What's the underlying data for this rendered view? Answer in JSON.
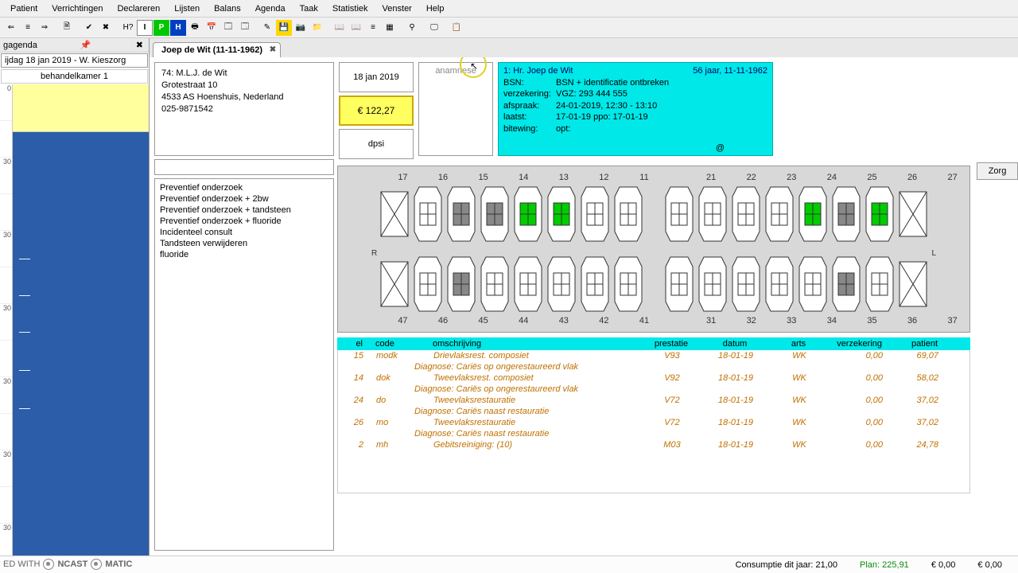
{
  "menubar": [
    "Patient",
    "Verrichtingen",
    "Declareren",
    "Lijsten",
    "Balans",
    "Agenda",
    "Taak",
    "Statistiek",
    "Venster",
    "Help"
  ],
  "toolbar_icons": [
    "⇐",
    "≡",
    "⇒",
    "",
    "🗎",
    "",
    "✔",
    "✖",
    "",
    "H?",
    "I",
    "P",
    "H",
    "🖶",
    "📅",
    "🗔",
    "🗔",
    "",
    "✎",
    "💾",
    "📷",
    "📁",
    "",
    "📖",
    "📖",
    "≡",
    "▦",
    "",
    "⚲",
    "",
    "🖵",
    "",
    "📋"
  ],
  "agenda": {
    "header": "gagenda",
    "date": "ijdag 18 jan 2019 - W. Kieszorg",
    "room": "behandelkamer 1",
    "times": [
      "0",
      "",
      "30",
      "",
      "30",
      "",
      "30",
      "",
      "30",
      "",
      "30",
      "",
      "30"
    ]
  },
  "tab": {
    "label": "Joep de Wit (11-11-1962)"
  },
  "address": {
    "l1": "74:  M.L.J. de Wit",
    "l2": "Grotestraat 10",
    "l3": "4533 AS  Hoenshuis, Nederland",
    "l4": "025-9871542"
  },
  "procedures": [
    "Preventief onderzoek",
    "Preventief onderzoek + 2bw",
    "Preventief onderzoek + tandsteen",
    "Preventief onderzoek + fluoride",
    "Incidenteel consult",
    "Tandsteen verwijderen",
    "fluoride"
  ],
  "box": {
    "date": "18 jan 2019",
    "price": "€ 122,27",
    "dpsi": "dpsi",
    "anam": "anamnese"
  },
  "info": {
    "name": "1: Hr. Joep de Wit",
    "age": "56 jaar, 11-11-1962",
    "r1l": "BSN:",
    "r1v": "BSN + identificatie ontbreken",
    "r2l": "verzekering:",
    "r2v": "VGZ: 293 444 555",
    "r3l": "afspraak:",
    "r3v": "24-01-2019, 12:30 - 13:10",
    "r4l": "laatst:",
    "r4v": "17-01-19    ppo: 17-01-19",
    "r5l": "bitewing:",
    "r5v": "              opt:",
    "mail": "@"
  },
  "zorg": "Zorg",
  "teeth_upper": [
    "17",
    "16",
    "15",
    "14",
    "13",
    "12",
    "11",
    "",
    "21",
    "22",
    "23",
    "24",
    "25",
    "26",
    "27"
  ],
  "teeth_lower": [
    "47",
    "46",
    "45",
    "44",
    "43",
    "42",
    "41",
    "",
    "31",
    "32",
    "33",
    "34",
    "35",
    "36",
    "37"
  ],
  "rl": {
    "r": "R",
    "l": "L"
  },
  "grid": {
    "headers": {
      "el": "el",
      "code": "code",
      "desc": "omschrijving",
      "pres": "prestatie",
      "date": "datum",
      "arts": "arts",
      "verz": "verzekering",
      "pat": "patient"
    },
    "rows": [
      {
        "el": "15",
        "code": "modk",
        "desc": "Drievlaksrest. composiet",
        "pres": "V93",
        "date": "18-01-19",
        "arts": "WK",
        "verz": "0,00",
        "pat": "69,07",
        "diag": "Diagnose: Cariës op ongerestaureerd vlak"
      },
      {
        "el": "14",
        "code": "dok",
        "desc": "Tweevlaksrest. composiet",
        "pres": "V92",
        "date": "18-01-19",
        "arts": "WK",
        "verz": "0,00",
        "pat": "58,02",
        "diag": "Diagnose: Cariës op ongerestaureerd vlak"
      },
      {
        "el": "24",
        "code": "do",
        "desc": "Tweevlaksrestauratie",
        "pres": "V72",
        "date": "18-01-19",
        "arts": "WK",
        "verz": "0,00",
        "pat": "37,02",
        "diag": "Diagnose: Cariës naast restauratie"
      },
      {
        "el": "26",
        "code": "mo",
        "desc": "Tweevlaksrestauratie",
        "pres": "V72",
        "date": "18-01-19",
        "arts": "WK",
        "verz": "0,00",
        "pat": "37,02",
        "diag": "Diagnose: Cariës naast restauratie"
      },
      {
        "el": "2",
        "code": "mh",
        "desc": "Gebitsreiniging: (10)",
        "pres": "M03",
        "date": "18-01-19",
        "arts": "WK",
        "verz": "0,00",
        "pat": "24,78",
        "diag": ""
      }
    ]
  },
  "footer": {
    "cons": "Consumptie dit jaar: 21,00",
    "plan": "Plan: 225,91",
    "v1": "€ 0,00",
    "v2": "€ 0,00"
  }
}
